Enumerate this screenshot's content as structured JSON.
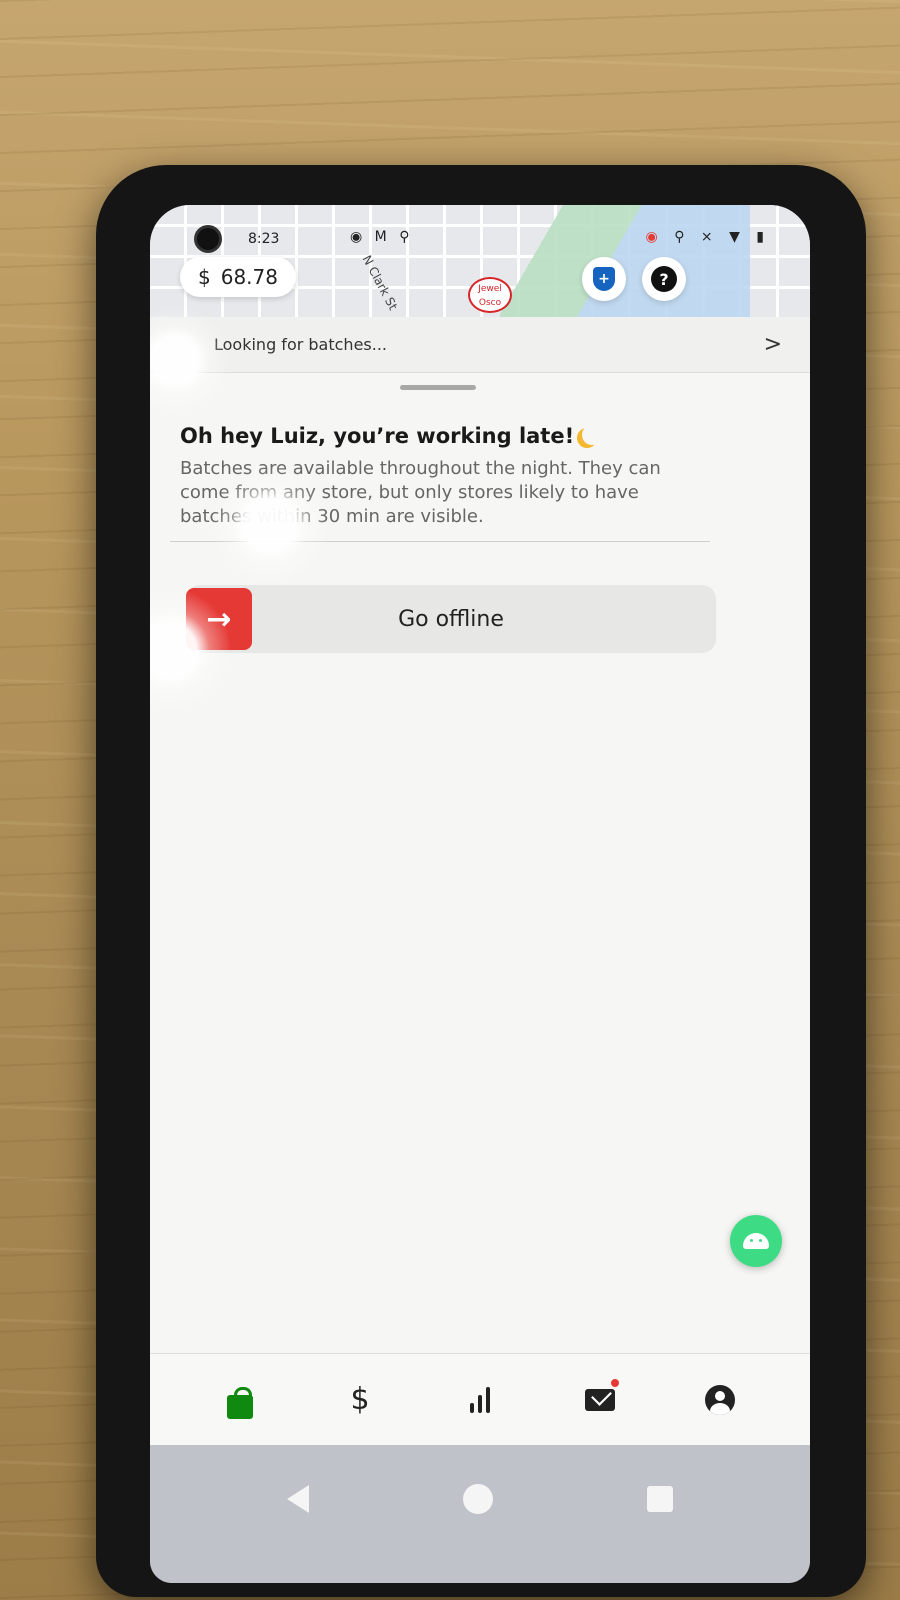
{
  "status_bar": {
    "time": "8:23",
    "left_icons": "◉ M ⚲",
    "right_icons": "◉ ⚲ ⨯ ▼ ▮"
  },
  "map": {
    "street_label": "N Clark St",
    "earnings": {
      "currency": "$",
      "amount": "68.78"
    },
    "store_pin_label": "Jewel Osco"
  },
  "looking_bar": {
    "label": "Looking for batches...",
    "chevron": ">"
  },
  "sheet": {
    "greeting": "Oh hey Luiz, you’re working late!",
    "description": "Batches are available throughout the night. They can come from any store, but only stores likely to have batches within 30 min are visible.",
    "offline_button": {
      "icon": "→",
      "label": "Go offline"
    }
  },
  "bottom_nav": {
    "items": [
      {
        "name": "batches",
        "icon": "bag-icon",
        "active": true
      },
      {
        "name": "earnings",
        "icon": "$"
      },
      {
        "name": "stats",
        "icon": "bar-chart-icon"
      },
      {
        "name": "messages",
        "icon": "mail-icon",
        "notification": true
      },
      {
        "name": "account",
        "icon": "person-icon"
      }
    ]
  },
  "colors": {
    "accent_red": "#e53935",
    "brand_green": "#108910",
    "android_green": "#3ddc84"
  }
}
